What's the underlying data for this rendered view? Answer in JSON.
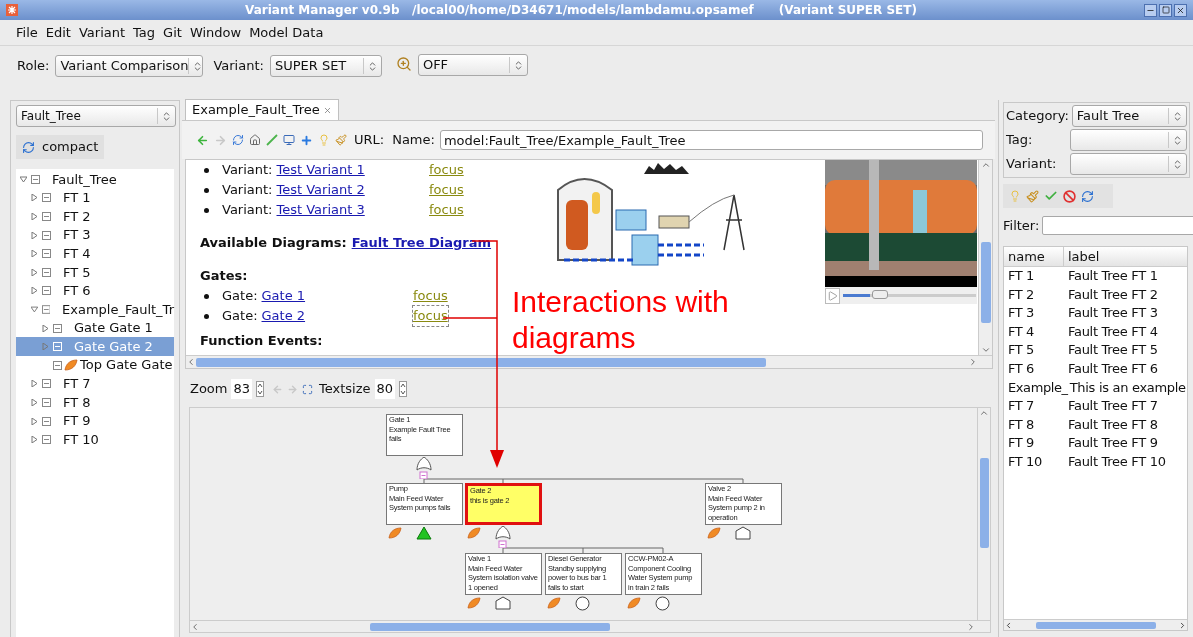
{
  "window": {
    "title": "Variant Manager v0.9b   /local00/home/D34671/models/lambdamu.opsamef      (Variant SUPER SET)"
  },
  "menu": [
    "File",
    "Edit",
    "Variant",
    "Tag",
    "Git",
    "Window",
    "Model Data"
  ],
  "toolbar": {
    "role_label": "Role:",
    "role": "Variant Comparison",
    "variant_label": "Variant:",
    "variant": "SUPER SET",
    "filter": "OFF"
  },
  "left": {
    "selector": "Fault_Tree",
    "compact_button": "compact",
    "tree": [
      {
        "label": "Fault_Tree",
        "kind": "node",
        "expanded": true,
        "selected": false,
        "children": [
          {
            "label": "FT 1",
            "kind": "node",
            "expanded": false,
            "selected": false
          },
          {
            "label": "FT 2",
            "kind": "node",
            "expanded": false,
            "selected": false
          },
          {
            "label": "FT 3",
            "kind": "node",
            "expanded": false,
            "selected": false
          },
          {
            "label": "FT 4",
            "kind": "node",
            "expanded": false,
            "selected": false
          },
          {
            "label": "FT 5",
            "kind": "node",
            "expanded": false,
            "selected": false
          },
          {
            "label": "FT 6",
            "kind": "node",
            "expanded": false,
            "selected": false
          },
          {
            "label": "Example_Fault_Tr",
            "kind": "node",
            "expanded": true,
            "selected": false,
            "children": [
              {
                "label": "Gate Gate 1",
                "kind": "node",
                "expanded": false,
                "selected": false
              },
              {
                "label": "Gate Gate 2",
                "kind": "node",
                "expanded": false,
                "selected": true
              },
              {
                "label": "Top Gate  Gate",
                "kind": "event",
                "selected": false
              }
            ]
          },
          {
            "label": "FT 7",
            "kind": "node",
            "expanded": false,
            "selected": false
          },
          {
            "label": "FT 8",
            "kind": "node",
            "expanded": false,
            "selected": false
          },
          {
            "label": "FT 9",
            "kind": "node",
            "expanded": false,
            "selected": false
          },
          {
            "label": "FT 10",
            "kind": "node",
            "expanded": false,
            "selected": false
          }
        ]
      }
    ]
  },
  "tab": {
    "label": "Example_Fault_Tree",
    "selected": true
  },
  "browser": {
    "url_label": "URL:",
    "name_label": "Name:",
    "name": "model:Fault_Tree/Example_Fault_Tree",
    "variants": [
      {
        "label": "Variant:",
        "link": "Test Variant 1",
        "focus": "focus"
      },
      {
        "label": "Variant:",
        "link": "Test Variant 2",
        "focus": "focus"
      },
      {
        "label": "Variant:",
        "link": "Test Variant 3",
        "focus": "focus"
      }
    ],
    "diagrams_label": "Available Diagrams:",
    "diagram_link": "Fault Tree Diagram",
    "gates_heading": "Gates:",
    "gates": [
      {
        "label": "Gate:",
        "link": "Gate 1",
        "focus": "focus",
        "selected": false
      },
      {
        "label": "Gate:",
        "link": "Gate 2",
        "focus": "focus",
        "selected": true
      }
    ],
    "function_events_heading": "Function Events:",
    "video": {
      "level": 0.2
    }
  },
  "annotation": "Interactions with diagrams",
  "diagram": {
    "zoom_label": "Zoom",
    "zoom": "83",
    "textsize_label": "Textsize",
    "textsize": "80",
    "nodes": [
      {
        "title": "Gate 1",
        "text": "Example Fault Tree fails",
        "kind": "gate",
        "selected": false,
        "variant_marker": false
      },
      {
        "title": "Pump",
        "text": "Main Feed Water System pumps fails",
        "kind": "undeveloped",
        "selected": false,
        "variant_marker": true
      },
      {
        "title": "Gate 2",
        "text": "this is gate 2",
        "kind": "gate",
        "selected": true,
        "variant_marker": true
      },
      {
        "title": "Valve 2",
        "text": "Main Feed Water System pump 2 in operation",
        "kind": "house",
        "selected": false,
        "variant_marker": true
      },
      {
        "title": "Valve 1",
        "text": "Main Feed Water System isolation valve 1 opened",
        "kind": "house",
        "selected": false,
        "variant_marker": true
      },
      {
        "title": "Diesel Generator",
        "text": "Standby supplying power to bus bar 1 fails to start",
        "kind": "basic",
        "selected": false,
        "variant_marker": true
      },
      {
        "title": "CCW-PM02-A",
        "text": "Component Cooling Water System pump in train 2 fails",
        "kind": "basic",
        "selected": false,
        "variant_marker": true
      }
    ]
  },
  "right": {
    "category_label": "Category:",
    "category": "Fault Tree",
    "tag_label": "Tag:",
    "variant_label": "Variant:",
    "filter_label": "Filter:",
    "columns": [
      "name",
      "label"
    ],
    "rows": [
      [
        "FT 1",
        "Fault Tree FT 1"
      ],
      [
        "FT 2",
        "Fault Tree FT 2"
      ],
      [
        "FT 3",
        "Fault Tree FT 3"
      ],
      [
        "FT 4",
        "Fault Tree FT 4"
      ],
      [
        "FT 5",
        "Fault Tree FT 5"
      ],
      [
        "FT 6",
        "Fault Tree FT 6"
      ],
      [
        "Example_",
        "This is an example"
      ],
      [
        "FT 7",
        "Fault Tree FT 7"
      ],
      [
        "FT 8",
        "Fault Tree FT 8"
      ],
      [
        "FT 9",
        "Fault Tree FT 9"
      ],
      [
        "FT 10",
        "Fault Tree FT 10"
      ]
    ]
  }
}
